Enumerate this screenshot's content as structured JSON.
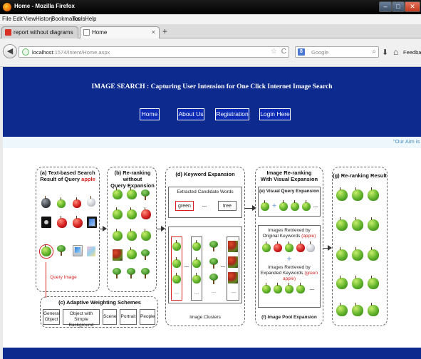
{
  "window": {
    "title": "Home - Mozilla Firefox",
    "min_glyph": "–",
    "max_glyph": "□",
    "close_glyph": "✕"
  },
  "menu": [
    "File",
    "Edit",
    "View",
    "History",
    "Bookmarks",
    "Tools",
    "Help"
  ],
  "tabs": [
    {
      "label": "report without diagrams (Please wait for ..."
    },
    {
      "label": "Home"
    }
  ],
  "tab_close_glyph": "×",
  "new_tab_glyph": "+",
  "navbar": {
    "url_host": "localhost",
    "url_rest": ":1574/Intent/Home.aspx",
    "search_placeholder": "Google",
    "search_engine_letter": "8",
    "back_glyph": "◀",
    "star_glyph": "☆",
    "reload_glyph": "C",
    "magnifier_glyph": "⌕",
    "download_glyph": "⬇",
    "home_glyph": "⌂",
    "feedback_label": "Feedback"
  },
  "site": {
    "title": "IMAGE SEARCH : Capturing User Intension for One Click Internet Image Search",
    "nav": [
      "Home",
      "About Us",
      "Registration",
      "Login Here"
    ],
    "marquee": "\"Our Aim is"
  },
  "diagram": {
    "a_title_1": "(a) Text-based Search",
    "a_title_2": "Result of Query",
    "a_query_word": "apple",
    "query_image_label": "Query Image",
    "b_title_1": "(b) Re-ranking without",
    "b_title_2": "Query Expansion",
    "c_title": "(c) Adaptive Weighting Schemes",
    "c_items": [
      "General Object",
      "Object with Simple Background",
      "Scene",
      "Portrait",
      "People"
    ],
    "d_title": "(d) Keyword Expansion",
    "d_extracted": "Extracted Candidate Words",
    "d_word_1": "green",
    "d_word_2": "tree",
    "ellipsis": "…",
    "d_clusters": "Image Clusters",
    "mid_title_1": "Image Re-ranking",
    "mid_title_2": "With Visual Expansion",
    "e_title": "(e) Visual Query Expansion",
    "pool_text_1": "Images Retrieved by",
    "pool_text_2": "Original Keywords",
    "pool_kw_1": "(apple)",
    "pool_text_3": "Images Retrieved by",
    "pool_text_4": "Expanded Keywords",
    "pool_kw_2": "(green apple)",
    "plus_glyph": "+",
    "f_title": "(f) Image Pool Expansion",
    "g_title": "(g) Re-ranking Result"
  },
  "colors": {
    "header_blue": "#0d2a8e",
    "nav_button_blue": "#0b2bb5",
    "highlight_red": "#d42020",
    "marquee_blue": "#4a90c4"
  }
}
